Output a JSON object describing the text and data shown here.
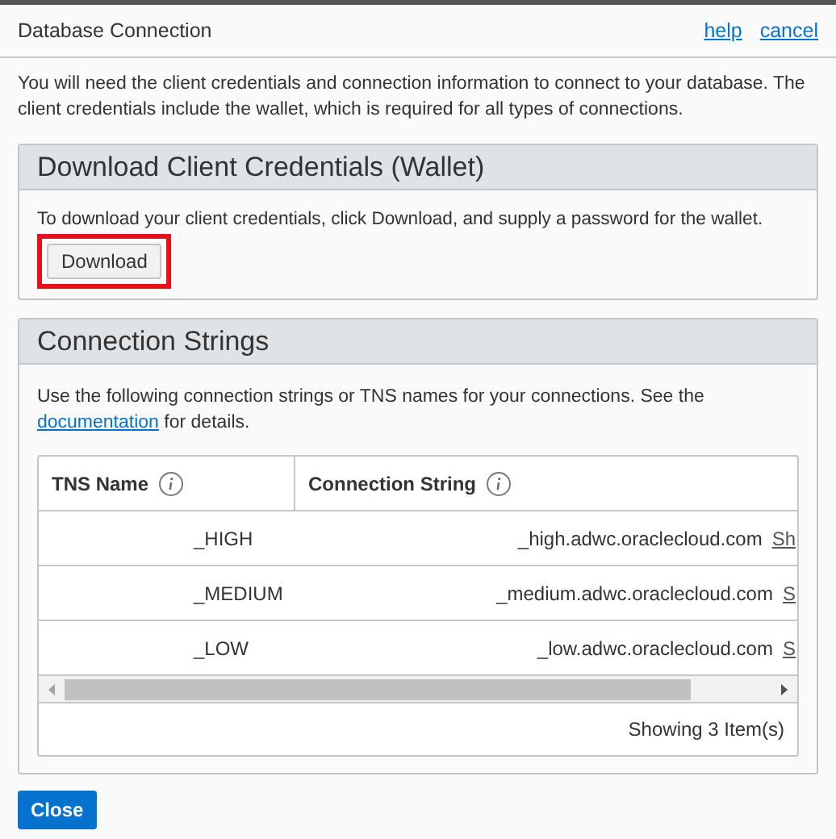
{
  "dialog": {
    "title": "Database Connection",
    "header_links": [
      "help",
      "cancel"
    ],
    "intro": "You will need the client credentials and connection information to connect to your database. The client credentials include the wallet, which is required for all types of connections."
  },
  "wallet_panel": {
    "title": "Download Client Credentials (Wallet)",
    "text": "To download your client credentials, click Download, and supply a password for the wallet.",
    "button": {
      "label": "Download",
      "highlighted": true
    }
  },
  "connection_panel": {
    "title": "Connection Strings",
    "text_before": "Use the following connection strings or TNS names for your connections. See the",
    "link": "documentation",
    "text_after": "for details.",
    "table": {
      "columns": [
        "TNS Name",
        "Connection String"
      ],
      "rows": [
        {
          "tns_name": "_HIGH",
          "connection_string": "_high.adwc.oraclecloud.com",
          "action": "Sh"
        },
        {
          "tns_name": "_MEDIUM",
          "connection_string": "_medium.adwc.oraclecloud.com",
          "action": "S"
        },
        {
          "tns_name": "_LOW",
          "connection_string": "_low.adwc.oraclecloud.com",
          "action": "S"
        }
      ],
      "footer": "Showing 3 Item(s)"
    }
  },
  "close_button": "Close"
}
